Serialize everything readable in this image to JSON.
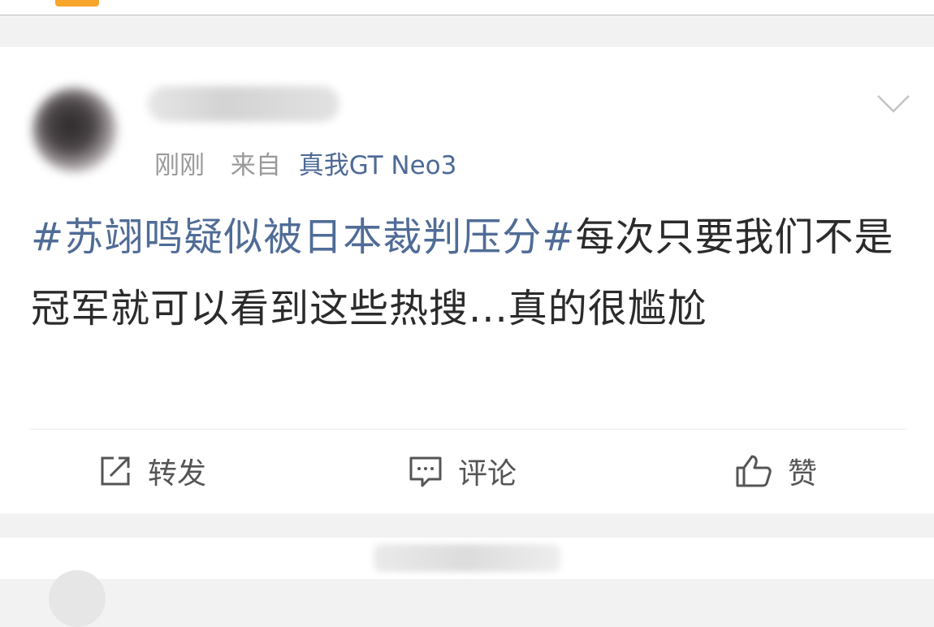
{
  "post": {
    "meta": {
      "time": "刚刚",
      "from_label": "来自",
      "device": "真我GT Neo3"
    },
    "content": {
      "hashtag": "#苏翊鸣疑似被日本裁判压分#",
      "text": "每次只要我们不是冠军就可以看到这些热搜...真的很尴尬"
    },
    "actions": {
      "repost_label": "转发",
      "comment_label": "评论",
      "like_label": "赞"
    }
  },
  "colors": {
    "accent": "#f7a52b",
    "link": "#506c97",
    "text": "#2b2b2b",
    "muted": "#9a9a9a"
  }
}
